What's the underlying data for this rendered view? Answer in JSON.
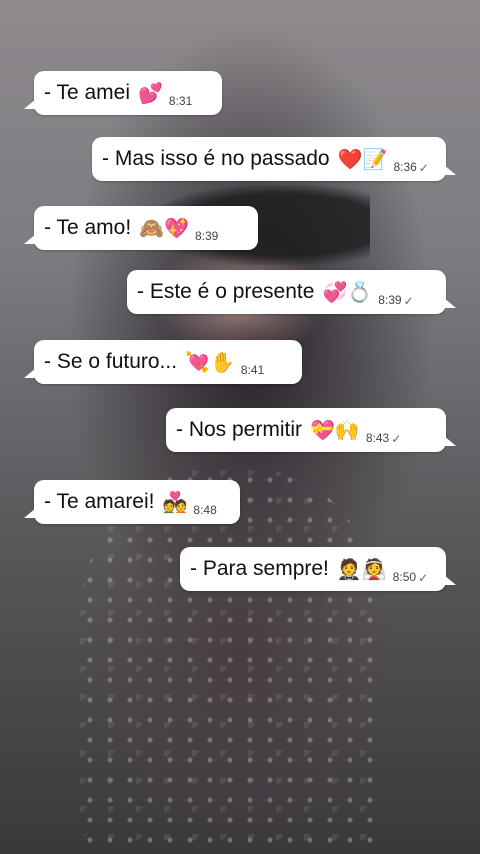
{
  "messages": [
    {
      "text": "- Te amei",
      "emoji": "💕",
      "time": "8:31",
      "side": "left",
      "check": ""
    },
    {
      "text": "- Mas isso é no passado",
      "emoji": "❤️📝",
      "time": "8:36",
      "side": "right",
      "check": "✓"
    },
    {
      "text": "-  Te amo!",
      "emoji": "🙈💖",
      "time": "8:39",
      "side": "left",
      "check": ""
    },
    {
      "text": "- Este é o presente",
      "emoji": "💞💍",
      "time": "8:39",
      "side": "right",
      "check": "✓"
    },
    {
      "text": "- Se o futuro...",
      "emoji": "💘✋",
      "time": "8:41",
      "side": "left",
      "check": ""
    },
    {
      "text": "-  Nos permitir",
      "emoji": "💝🙌",
      "time": "8:43",
      "side": "right",
      "check": "✓"
    },
    {
      "text": "- Te amarei!",
      "emoji": "💑",
      "time": "8:48",
      "side": "left",
      "check": ""
    },
    {
      "text": "- Para sempre!",
      "emoji": "🤵👰",
      "time": "8:50",
      "side": "right",
      "check": "✓"
    }
  ]
}
